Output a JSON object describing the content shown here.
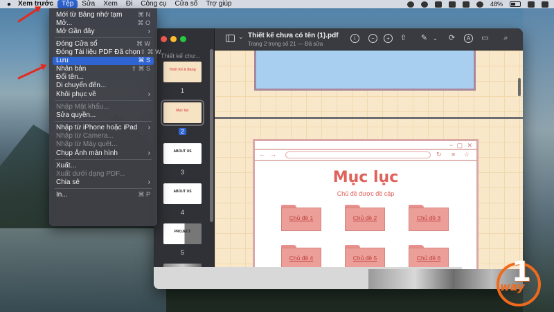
{
  "menubar": {
    "app": "Xem trước",
    "items": [
      "Tệp",
      "Sửa",
      "Xem",
      "Đi",
      "Công cụ",
      "Cửa sổ",
      "Trợ giúp"
    ],
    "battery": "48%"
  },
  "file_menu": {
    "groups": [
      [
        {
          "label": "Mới từ Bảng nhớ tạm",
          "shortcut": "⌘ N",
          "enabled": true
        },
        {
          "label": "Mở...",
          "shortcut": "⌘ O",
          "enabled": true
        },
        {
          "label": "Mở Gần đây",
          "submenu": true,
          "enabled": true
        }
      ],
      [
        {
          "label": "Đóng Cửa sổ",
          "shortcut": "⌘ W",
          "enabled": true
        },
        {
          "label": "Đóng Tài liệu PDF Đã chọn",
          "shortcut": "⇧ ⌘ W",
          "enabled": true
        },
        {
          "label": "Lưu",
          "shortcut": "⌘ S",
          "enabled": true,
          "highlighted": true
        },
        {
          "label": "Nhân bản",
          "shortcut": "⇧ ⌘ S",
          "enabled": true
        },
        {
          "label": "Đổi tên...",
          "enabled": true
        },
        {
          "label": "Di chuyển đến...",
          "enabled": true
        },
        {
          "label": "Khôi phục về",
          "submenu": true,
          "enabled": true
        }
      ],
      [
        {
          "label": "Nhập Mật khẩu...",
          "enabled": false
        },
        {
          "label": "Sửa quyền...",
          "enabled": true
        }
      ],
      [
        {
          "label": "Nhập từ iPhone hoặc iPad",
          "submenu": true,
          "enabled": true
        },
        {
          "label": "Nhập từ Camera...",
          "enabled": false
        },
        {
          "label": "Nhập từ Máy quét...",
          "enabled": false
        },
        {
          "label": "Chụp Ảnh màn hình",
          "submenu": true,
          "enabled": true
        }
      ],
      [
        {
          "label": "Xuất...",
          "enabled": true
        },
        {
          "label": "Xuất dưới dạng PDF...",
          "enabled": false
        },
        {
          "label": "Chia sẻ",
          "submenu": true,
          "enabled": true
        }
      ],
      [
        {
          "label": "In...",
          "shortcut": "⌘ P",
          "enabled": true
        }
      ]
    ]
  },
  "window": {
    "title": "Thiết kế chưa có tên (1).pdf",
    "subtitle": "Trang 2 trong số 21 — Đã sửa",
    "sidebar_title": "Thiết kế chư...",
    "thumbnails": [
      {
        "num": "1",
        "kind": "cover",
        "text": "Thiết Kế & Bảng"
      },
      {
        "num": "2",
        "kind": "toc",
        "text": "Mục lục",
        "selected": true
      },
      {
        "num": "3",
        "kind": "about",
        "text": "ABOUT US"
      },
      {
        "num": "4",
        "kind": "about",
        "text": "ABOUT US"
      },
      {
        "num": "5",
        "kind": "project",
        "text": "PROJECT"
      },
      {
        "num": "",
        "kind": "photo",
        "text": ""
      }
    ]
  },
  "page": {
    "heading": "Mục lục",
    "subheading": "Chủ đề được đề cập",
    "folders": [
      "Chủ đề 1",
      "Chủ đề 2",
      "Chủ đề 3",
      "Chủ đề 4",
      "Chủ đề 5",
      "Chủ đề 6"
    ]
  },
  "logo": {
    "number": "1",
    "text": "way"
  },
  "colors": {
    "accent": "#2f64d3",
    "page_heading": "#e0605a",
    "annotation_arrow": "#e32a1f"
  }
}
